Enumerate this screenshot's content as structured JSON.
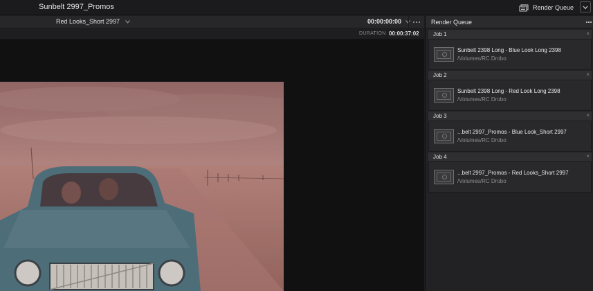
{
  "titlebar": {
    "project_title": "Sunbelt 2997_Promos",
    "render_queue_toggle_label": "Render Queue",
    "icons": {
      "render_queue": "render-queue-icon",
      "collapse": "chevron-down-icon"
    }
  },
  "viewer": {
    "clip_name": "Red Looks_Short 2997",
    "timecode": "00:00:00:00",
    "duration_label": "DURATION",
    "duration_value": "00:00:37:02",
    "icons": {
      "clip_dropdown": "chevron-down-icon",
      "timecode_dropdown": "chevron-down-icon",
      "more": "more-options-icon"
    }
  },
  "render_queue": {
    "title": "Render Queue",
    "jobs": [
      {
        "label": "Job 1",
        "name": "Sunbelt 2398 Long - Blue Look Long 2398",
        "path": "/Volumes/RC Drobo"
      },
      {
        "label": "Job 2",
        "name": "Sunbelt 2398 Long - Red Look Long 2398",
        "path": "/Volumes/RC Drobo"
      },
      {
        "label": "Job 3",
        "name": "...belt 2997_Promos - Blue Look_Short 2997",
        "path": "/Volumes/RC Drobo"
      },
      {
        "label": "Job 4",
        "name": "...belt 2997_Promos - Red Looks_Short 2997",
        "path": "/Volumes/RC Drobo"
      }
    ],
    "close_glyph": "×"
  },
  "colors": {
    "background": "#1c1c1e",
    "panel": "#222225",
    "viewer_bg": "#111112",
    "frame_tint": "#b9817c",
    "car_body": "#3f6a78"
  }
}
